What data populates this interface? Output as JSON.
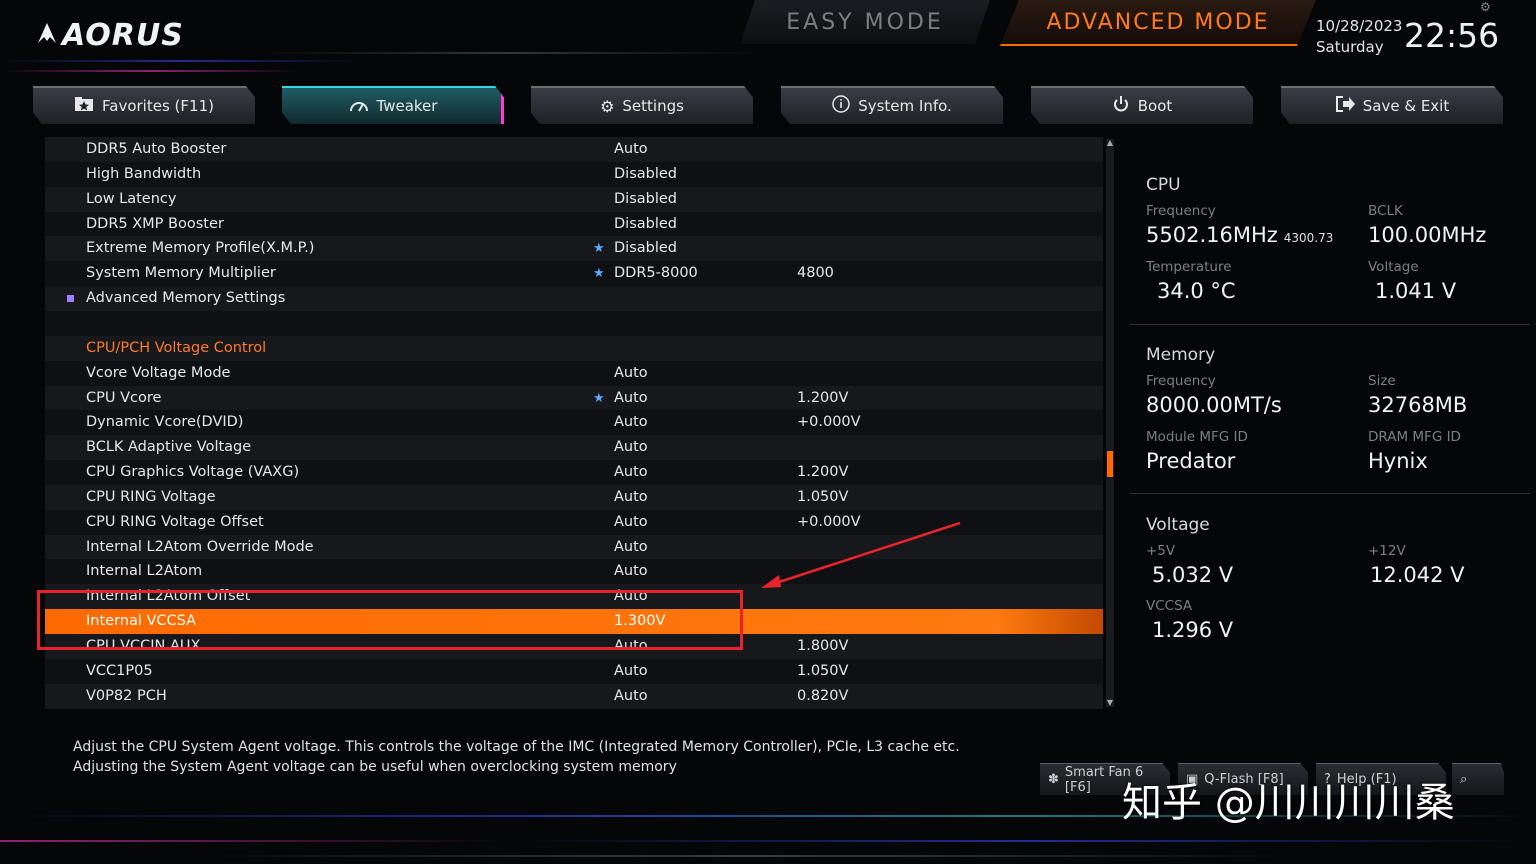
{
  "brand": {
    "name": "AORUS"
  },
  "modes": {
    "easy": "EASY MODE",
    "advanced": "ADVANCED MODE"
  },
  "clock": {
    "date": "10/28/2023",
    "day": "Saturday",
    "time": "22:56"
  },
  "tabs": [
    {
      "label": "Favorites (F11)",
      "icon": "star-folder-icon"
    },
    {
      "label": "Tweaker",
      "icon": "gauge-icon"
    },
    {
      "label": "Settings",
      "icon": "gear-icon"
    },
    {
      "label": "System Info.",
      "icon": "info-icon"
    },
    {
      "label": "Boot",
      "icon": "power-icon"
    },
    {
      "label": "Save & Exit",
      "icon": "exit-icon"
    }
  ],
  "active_tab": "Tweaker",
  "rows": [
    {
      "label": "DDR5 Auto Booster",
      "value": "Auto",
      "value2": ""
    },
    {
      "label": "High Bandwidth",
      "value": "Disabled",
      "value2": ""
    },
    {
      "label": "Low Latency",
      "value": "Disabled",
      "value2": ""
    },
    {
      "label": "DDR5 XMP Booster",
      "value": "Disabled",
      "value2": ""
    },
    {
      "label": "Extreme Memory Profile(X.M.P.)",
      "value": "Disabled",
      "value2": "",
      "star": true
    },
    {
      "label": "System Memory Multiplier",
      "value": "DDR5-8000",
      "value2": "4800",
      "star": true
    },
    {
      "label": "Advanced Memory Settings",
      "value": "",
      "value2": "",
      "submenu": true
    },
    {
      "label": "",
      "value": "",
      "value2": ""
    },
    {
      "label": "CPU/PCH Voltage Control",
      "value": "",
      "value2": "",
      "section": true
    },
    {
      "label": "Vcore Voltage Mode",
      "value": "Auto",
      "value2": ""
    },
    {
      "label": "CPU Vcore",
      "value": "Auto",
      "value2": "1.200V",
      "star": true
    },
    {
      "label": "Dynamic Vcore(DVID)",
      "value": "Auto",
      "value2": "+0.000V"
    },
    {
      "label": "BCLK Adaptive Voltage",
      "value": "Auto",
      "value2": ""
    },
    {
      "label": "CPU Graphics Voltage (VAXG)",
      "value": "Auto",
      "value2": "1.200V"
    },
    {
      "label": "CPU RING Voltage",
      "value": "Auto",
      "value2": "1.050V"
    },
    {
      "label": "CPU RING Voltage Offset",
      "value": "Auto",
      "value2": "+0.000V"
    },
    {
      "label": "Internal L2Atom Override Mode",
      "value": "Auto",
      "value2": ""
    },
    {
      "label": "Internal L2Atom",
      "value": "Auto",
      "value2": ""
    },
    {
      "label": "Internal L2Atom Offset",
      "value": "Auto",
      "value2": ""
    },
    {
      "label": "Internal VCCSA",
      "value": "1.300V",
      "value2": "",
      "selected": true
    },
    {
      "label": "CPU VCCIN AUX",
      "value": "Auto",
      "value2": "1.800V"
    },
    {
      "label": "VCC1P05",
      "value": "Auto",
      "value2": "1.050V"
    },
    {
      "label": "V0P82 PCH",
      "value": "Auto",
      "value2": "0.820V"
    }
  ],
  "panel": {
    "cpu": {
      "title": "CPU",
      "freq_label": "Frequency",
      "freq": "5502.16MHz",
      "freq_sub": "4300.73",
      "bclk_label": "BCLK",
      "bclk": "100.00MHz",
      "temp_label": "Temperature",
      "temp": "34.0 °C",
      "volt_label": "Voltage",
      "volt": "1.041 V"
    },
    "memory": {
      "title": "Memory",
      "freq_label": "Frequency",
      "freq": "8000.00MT/s",
      "size_label": "Size",
      "size": "32768MB",
      "module_label": "Module MFG ID",
      "module": "Predator",
      "dram_label": "DRAM MFG ID",
      "dram": "Hynix"
    },
    "voltage": {
      "title": "Voltage",
      "v5_label": "+5V",
      "v5": "5.032 V",
      "v12_label": "+12V",
      "v12": "12.042 V",
      "vccsa_label": "VCCSA",
      "vccsa": "1.296 V"
    }
  },
  "help_text": {
    "line1": "Adjust the CPU System Agent voltage. This controls the voltage of the IMC (Integrated Memory Controller), PCIe, L3 cache etc.",
    "line2": "Adjusting the System Agent voltage can be useful when overclocking system memory"
  },
  "bottom_buttons": [
    {
      "label": "Smart Fan 6 [F6]",
      "icon": "fan-icon"
    },
    {
      "label": "Q-Flash [F8]",
      "icon": "flash-icon"
    },
    {
      "label": "Help (F1)",
      "icon": "help-icon"
    },
    {
      "label": "",
      "icon": "search-icon"
    }
  ],
  "watermark": "知乎 @川川川川桑",
  "colors": {
    "accent": "#ff6a00",
    "highlight_box": "#e8242a",
    "section": "#ff7a2a",
    "active_tab": "#35d6e0"
  }
}
